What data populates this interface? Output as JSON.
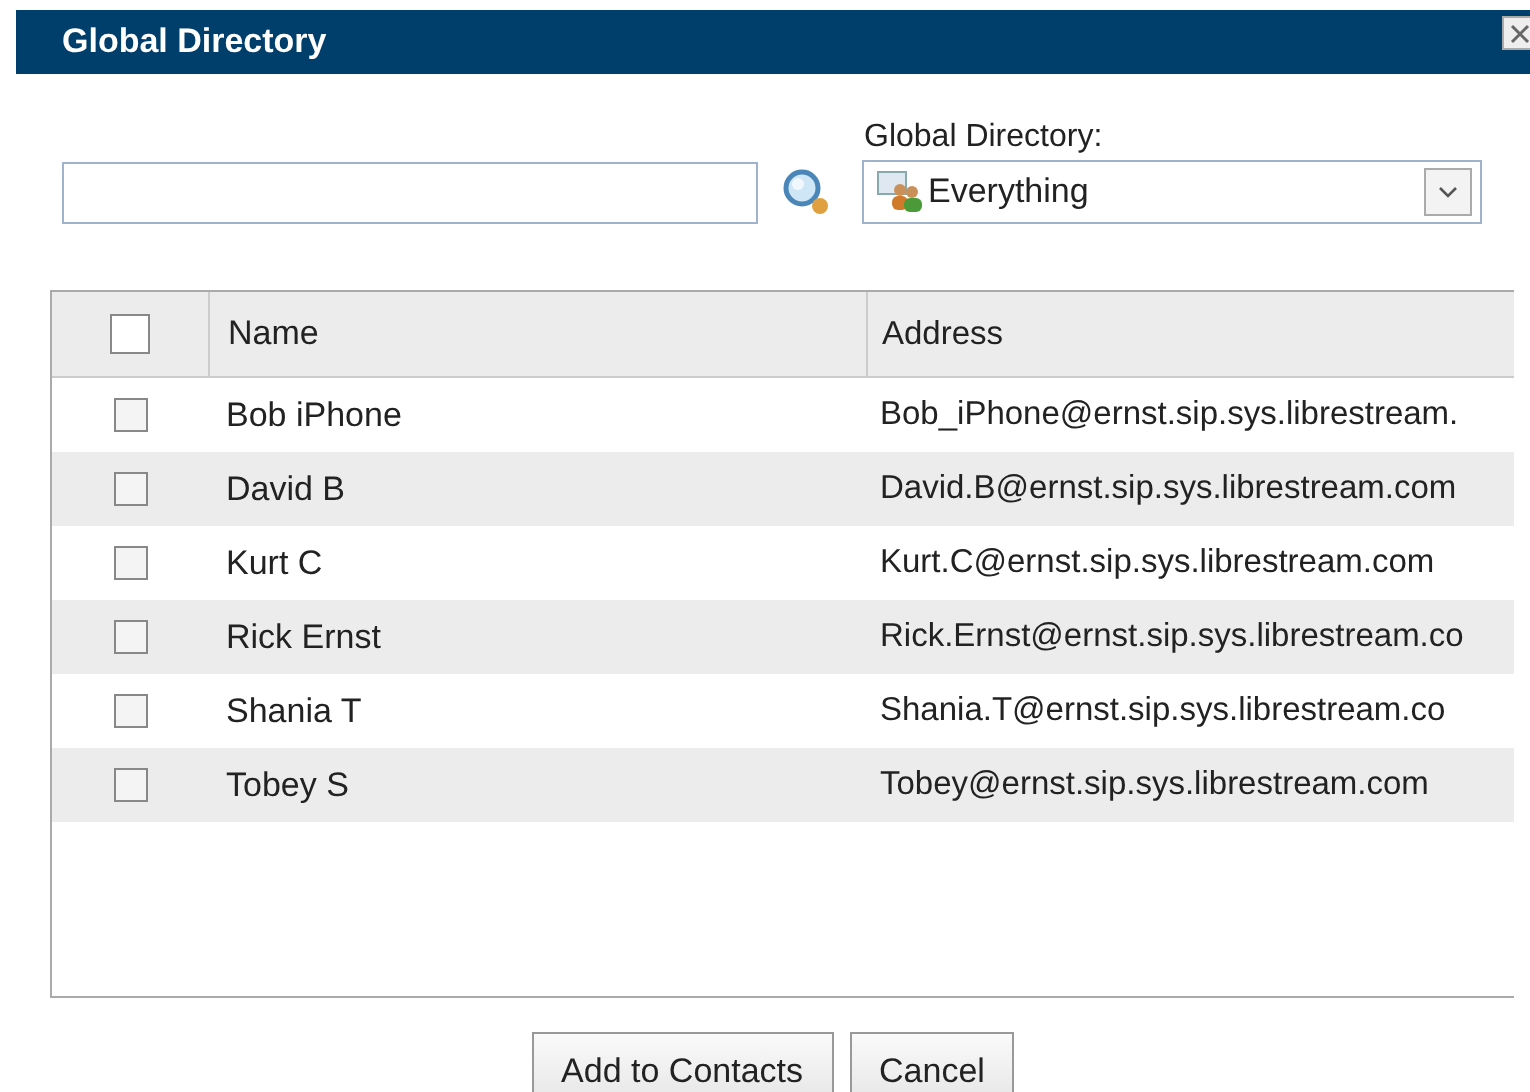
{
  "window": {
    "title": "Global Directory"
  },
  "directory": {
    "label": "Global Directory:",
    "value": "Everything"
  },
  "table": {
    "select_all": {
      "checked": false
    },
    "columns": [
      "Name",
      "Address"
    ],
    "rows": [
      {
        "checked": false,
        "name": "Bob iPhone",
        "address": "Bob_iPhone@ernst.sip.sys.librestream."
      },
      {
        "checked": false,
        "name": "David B",
        "address": "David.B@ernst.sip.sys.librestream.com"
      },
      {
        "checked": false,
        "name": "Kurt C",
        "address": "Kurt.C@ernst.sip.sys.librestream.com"
      },
      {
        "checked": false,
        "name": "Rick Ernst",
        "address": "Rick.Ernst@ernst.sip.sys.librestream.co"
      },
      {
        "checked": false,
        "name": "Shania T",
        "address": "Shania.T@ernst.sip.sys.librestream.co"
      },
      {
        "checked": false,
        "name": "Tobey S",
        "address": "Tobey@ernst.sip.sys.librestream.com"
      }
    ]
  },
  "buttons": [
    "Add to Contacts",
    "Cancel"
  ]
}
